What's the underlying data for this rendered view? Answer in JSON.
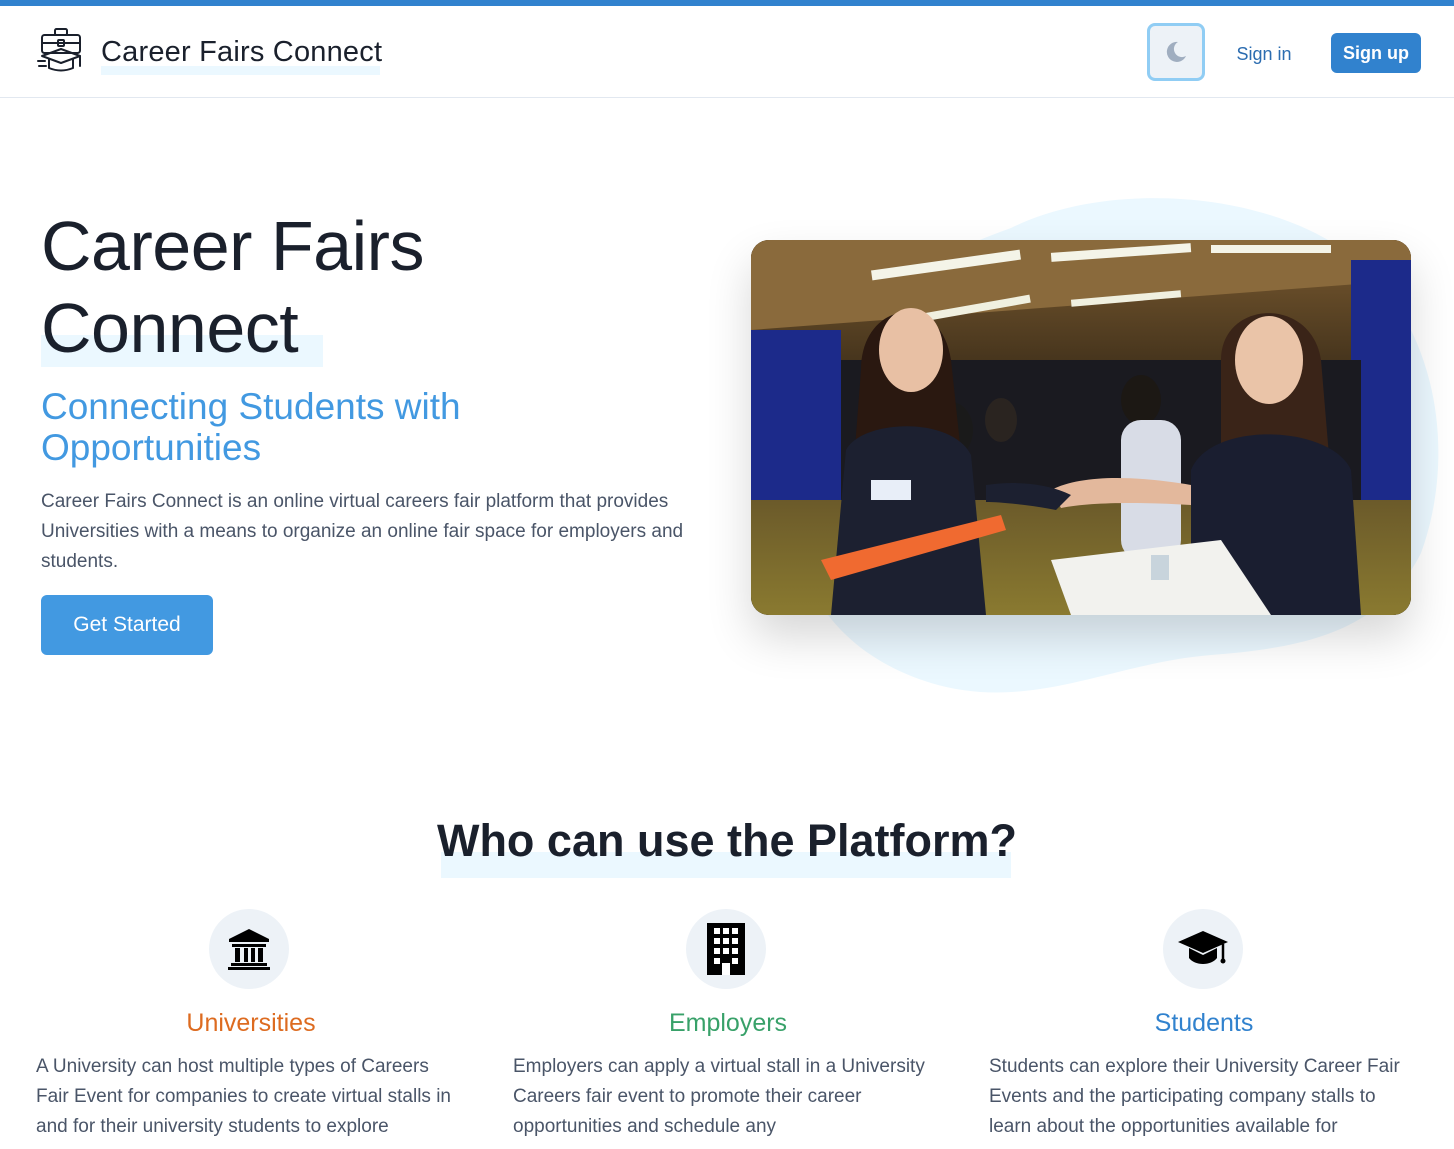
{
  "header": {
    "brand": "Career Fairs Connect",
    "signin_label": "Sign in",
    "signup_label": "Sign up",
    "theme_icon": "moon-icon",
    "logo_icon": "briefcase-graduation-cap-logo"
  },
  "hero": {
    "title_line1": "Career Fairs",
    "title_line2": "Connect",
    "subtitle": "Connecting Students with Opportunities",
    "description": "Career Fairs Connect is an online virtual careers fair platform that provides Universities with a means to organize an online fair space for employers and students.",
    "cta_label": "Get Started"
  },
  "section": {
    "title": "Who can use the Platform?"
  },
  "features": [
    {
      "title": "Universities",
      "icon": "university-building-icon",
      "color": "#dd6b20",
      "description": "A University can host multiple types of Careers Fair Event for companies to create virtual stalls in and for their university students to explore"
    },
    {
      "title": "Employers",
      "icon": "office-building-icon",
      "color": "#38a169",
      "description": "Employers can apply a virtual stall in a University Careers fair event to promote their career opportunities and schedule any"
    },
    {
      "title": "Students",
      "icon": "graduation-cap-icon",
      "color": "#3182ce",
      "description": "Students can explore their University Career Fair Events and the participating company stalls to learn about the opportunities available for"
    }
  ],
  "colors": {
    "accent": "#3182ce",
    "highlight": "#ebf8ff",
    "subtitle": "#4299e1"
  }
}
